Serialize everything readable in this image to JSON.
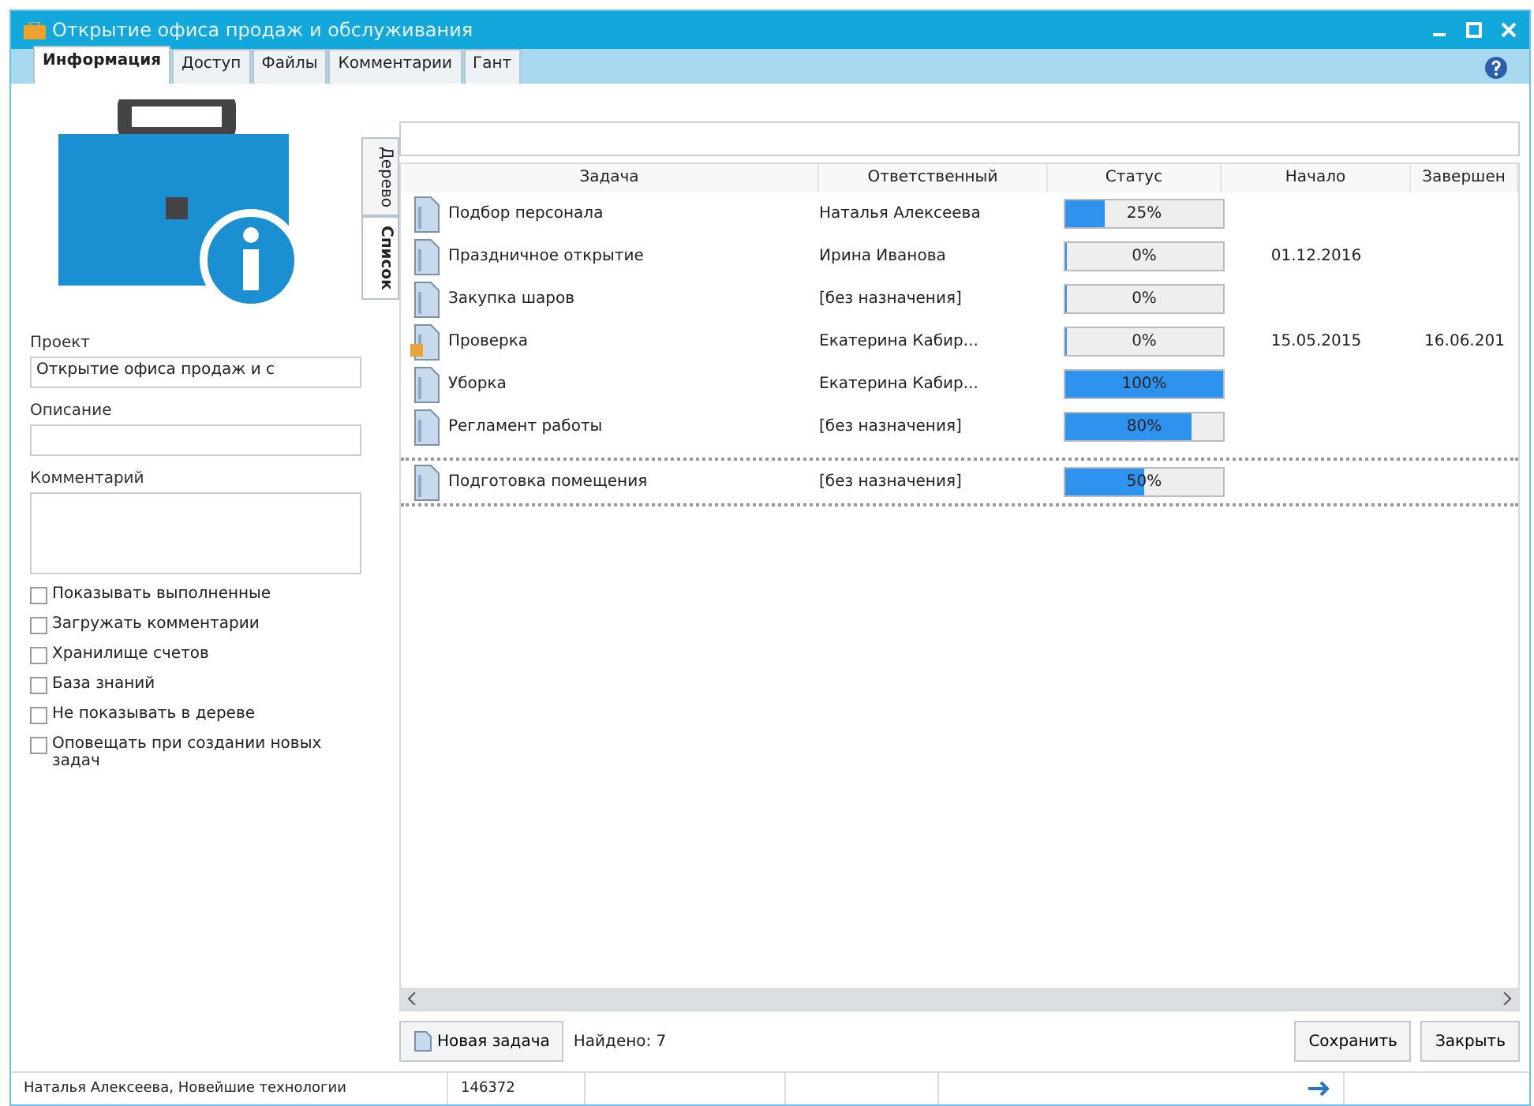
{
  "window": {
    "title": "Открытие офиса продаж и обслуживания"
  },
  "tabs": [
    {
      "label": "Информация",
      "selected": true
    },
    {
      "label": "Доступ",
      "selected": false
    },
    {
      "label": "Файлы",
      "selected": false
    },
    {
      "label": "Комментарии",
      "selected": false
    },
    {
      "label": "Гант",
      "selected": false
    }
  ],
  "side_tabs": [
    {
      "label": "Дерево",
      "selected": false
    },
    {
      "label": "Список",
      "selected": true
    }
  ],
  "form": {
    "project_label": "Проект",
    "project_value": "Открытие офиса продаж и с",
    "description_label": "Описание",
    "comment_label": "Комментарий",
    "options": [
      {
        "label": "Показывать выполненные",
        "checked": false
      },
      {
        "label": "Загружать комментарии",
        "checked": false
      },
      {
        "label": "Хранилище счетов",
        "checked": false
      },
      {
        "label": "База знаний",
        "checked": false
      },
      {
        "label": "Не показывать в дереве",
        "checked": false
      },
      {
        "label": "Оповещать при создании новых задач",
        "checked": false
      }
    ]
  },
  "table": {
    "columns": [
      "Задача",
      "Ответственный",
      "Статус",
      "Начало",
      "Завершен"
    ],
    "rows": [
      {
        "task": "Подбор персонала",
        "owner": "Наталья Алексеева",
        "status": "25%",
        "level": 0.25,
        "start": "",
        "end": "",
        "flagged": false,
        "selected": false
      },
      {
        "task": "Праздничное открытие",
        "owner": "Ирина Иванова",
        "status": "0%",
        "level": 0,
        "start": "01.12.2016",
        "end": "",
        "flagged": false,
        "selected": false
      },
      {
        "task": "Закупка шаров",
        "owner": "[без назначения]",
        "status": "0%",
        "level": 0,
        "start": "",
        "end": "",
        "flagged": false,
        "selected": false
      },
      {
        "task": "Проверка",
        "owner": "Екатерина Кабир...",
        "status": "0%",
        "level": 0,
        "start": "15.05.2015",
        "end": "16.06.201",
        "flagged": true,
        "selected": false
      },
      {
        "task": "Уборка",
        "owner": "Екатерина Кабир...",
        "status": "100%",
        "level": 1,
        "start": "",
        "end": "",
        "flagged": false,
        "selected": false
      },
      {
        "task": "Регламент работы",
        "owner": "[без назначения]",
        "status": "80%",
        "level": 0.8,
        "start": "",
        "end": "",
        "flagged": false,
        "selected": false
      },
      {
        "task": "Подготовка помещения",
        "owner": "[без назначения]",
        "status": "50%",
        "level": 0.5,
        "start": "",
        "end": "",
        "flagged": false,
        "selected": true
      }
    ]
  },
  "footer": {
    "new_task": "Новая задача",
    "found": "Найдено: 7",
    "save": "Сохранить",
    "close": "Закрыть"
  },
  "status_bar": {
    "user": "Наталья Алексеева, Новейшие технологии",
    "id": "146372"
  }
}
